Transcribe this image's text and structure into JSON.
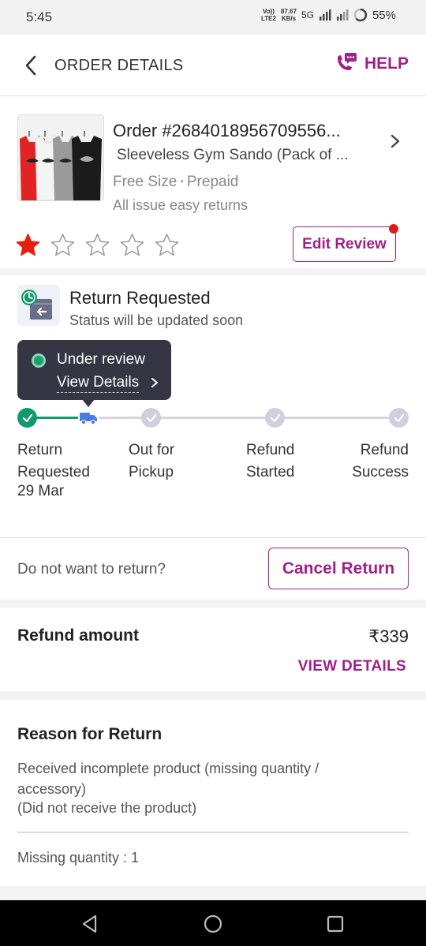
{
  "status_bar": {
    "time": "5:45",
    "volte": "Vo))",
    "lte": "LTE2",
    "speed": "87.67",
    "speed_unit": "KB/s",
    "network": "5G",
    "battery": "55%"
  },
  "header": {
    "title": "ORDER DETAILS",
    "help_label": "HELP"
  },
  "order": {
    "order_id": "Order #2684018956709556...",
    "product_name": "Sleeveless Gym Sando (Pack of ...",
    "size": "Free Size",
    "payment": "Prepaid",
    "returns_note": "All issue easy returns",
    "rating": 1,
    "max_rating": 5,
    "edit_review_label": "Edit Review"
  },
  "return_status": {
    "title": "Return Requested",
    "subtitle": "Status will be updated soon",
    "tooltip_status": "Under review",
    "tooltip_link": "View Details",
    "stages": [
      {
        "label_line1": "Return",
        "label_line2": "Requested",
        "date": "29 Mar"
      },
      {
        "label_line1": "Out for",
        "label_line2": "Pickup"
      },
      {
        "label_line1": "Refund",
        "label_line2": "Started"
      },
      {
        "label_line1": "Refund",
        "label_line2": "Success"
      }
    ]
  },
  "cancel": {
    "question": "Do not want to return?",
    "button_label": "Cancel Return"
  },
  "refund": {
    "label": "Refund amount",
    "amount": "₹339",
    "view_details_label": "VIEW DETAILS"
  },
  "reason": {
    "title": "Reason for Return",
    "text": "Received incomplete product (missing quantity / accessory)",
    "sub_text": "(Did not receive the product)",
    "missing_quantity": "Missing quantity : 1"
  },
  "colors": {
    "accent": "#9f2089",
    "success": "#0f9b6a",
    "star_filled": "#e5200f",
    "tooltip_bg": "#353543"
  }
}
